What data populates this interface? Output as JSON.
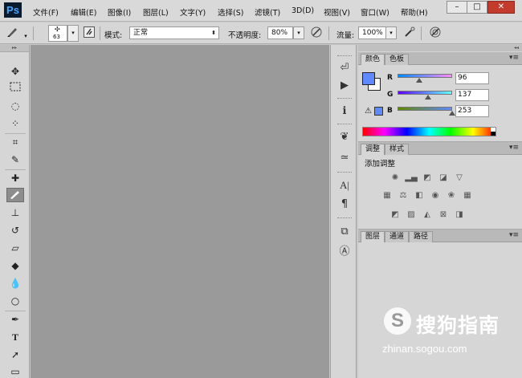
{
  "app": {
    "logo": "Ps"
  },
  "menu": [
    "文件(F)",
    "编辑(E)",
    "图像(I)",
    "图层(L)",
    "文字(Y)",
    "选择(S)",
    "滤镜(T)",
    "3D(D)",
    "视图(V)",
    "窗口(W)",
    "帮助(H)"
  ],
  "window_controls": {
    "minimize": "–",
    "maximize": "□",
    "close": "✕"
  },
  "options": {
    "brush_size": "63",
    "mode_label": "模式:",
    "mode_value": "正常",
    "opacity_label": "不透明度:",
    "opacity_value": "80%",
    "flow_label": "流量:",
    "flow_value": "100%"
  },
  "tools": [
    "move-icon",
    "marquee-icon",
    "lasso-icon",
    "quick-select-icon",
    "crop-icon",
    "eyedropper-icon",
    "healing-icon",
    "brush-icon",
    "stamp-icon",
    "history-brush-icon",
    "eraser-icon",
    "bucket-icon",
    "blur-icon",
    "dodge-icon",
    "pen-icon",
    "type-icon",
    "path-select-icon",
    "shape-icon"
  ],
  "active_tool": "brush-icon",
  "panels": {
    "color": {
      "tabs": [
        "颜色",
        "色板"
      ],
      "r_label": "R",
      "g_label": "G",
      "b_label": "B",
      "r": "96",
      "g": "137",
      "b": "253",
      "r_fraction": 0.376,
      "g_fraction": 0.537,
      "b_fraction": 0.992,
      "foreground": "#6089fd",
      "background": "#ffffff"
    },
    "adjustments": {
      "tabs": [
        "调整",
        "样式"
      ],
      "title": "添加调整"
    },
    "layers": {
      "tabs": [
        "图层",
        "通道",
        "路径"
      ]
    }
  },
  "watermark": {
    "brand": "搜狗指南",
    "url": "zhinan.sogou.com"
  }
}
